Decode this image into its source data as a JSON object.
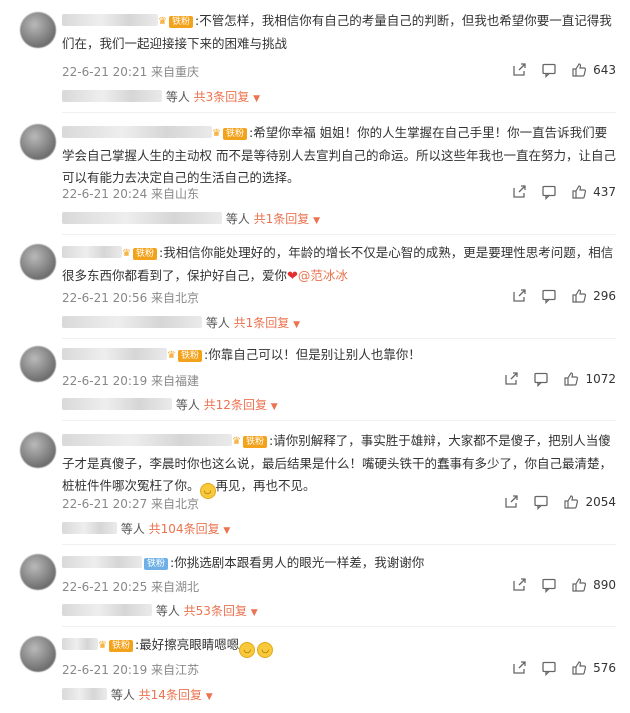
{
  "badge_fan": "铁粉",
  "mention": "@范冰冰",
  "comments": [
    {
      "text": ":不管怎样，我相信你有自己的考量自己的判断，但我也希望你要一直记得我们在，我们一起迎接接下来的困难与挑战",
      "meta": "22-6-21 20:21 来自重庆",
      "likes": "643",
      "replies_pre": "等人",
      "replies_more": "共3条回复"
    },
    {
      "text": ":希望你幸福 姐姐！你的人生掌握在自己手里！你一直告诉我们要学会自己掌握人生的主动权 而不是等待别人去宣判自己的命运。所以这些年我也一直在努力，让自己可以有能力去决定自己的生活自己的选择。",
      "meta": "22-6-21 20:24 来自山东",
      "likes": "437",
      "replies_pre": "等人",
      "replies_more": "共1条回复"
    },
    {
      "text": ":我相信你能处理好的，年龄的增长不仅是心智的成熟，更是要理性思考问题，相信很多东西你都看到了，保护好自己，爱你",
      "meta": "22-6-21 20:56 来自北京",
      "likes": "296",
      "replies_pre": "等人",
      "replies_more": "共1条回复"
    },
    {
      "text": ":你靠自己可以！但是别让别人也靠你！",
      "meta": "22-6-21 20:19 来自福建",
      "likes": "1072",
      "replies_pre": "等人",
      "replies_more": "共12条回复"
    },
    {
      "text": ":请你别解释了，事实胜于雄辩，大家都不是傻子，把别人当傻子才是真傻子，李晨时你也这么说，最后结果是什么！嘴硬头铁干的蠢事有多少了，你自己最清楚，桩桩件件哪次冤枉了你。",
      "text_tail": "再见，再也不见。",
      "meta": "22-6-21 20:27 来自北京",
      "likes": "2054",
      "replies_pre": "等人",
      "replies_more": "共104条回复"
    },
    {
      "text": ":你挑选剧本跟看男人的眼光一样差，我谢谢你",
      "meta": "22-6-21 20:25 来自湖北",
      "likes": "890",
      "replies_pre": "等人",
      "replies_more": "共53条回复"
    },
    {
      "text": ":最好擦亮眼睛嗯嗯",
      "meta": "22-6-21 20:19 来自江苏",
      "likes": "576",
      "replies_pre": "等人",
      "replies_more": "共14条回复"
    }
  ]
}
